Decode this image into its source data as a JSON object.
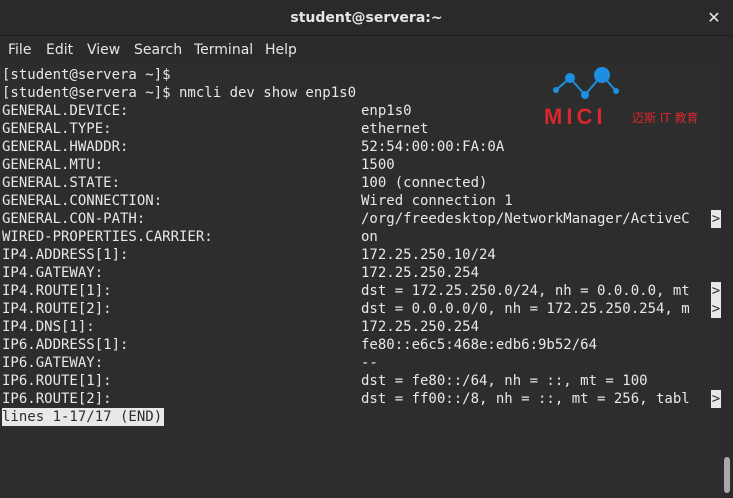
{
  "window": {
    "title": "student@servera:~"
  },
  "menu": [
    "File",
    "Edit",
    "View",
    "Search",
    "Terminal",
    "Help"
  ],
  "logo": {
    "brand": "MICI",
    "tagline": "迈斯 IT 教育"
  },
  "terminal": {
    "prompt1": "[student@servera ~]$",
    "prompt2": "[student@servera ~]$ nmcli dev show enp1s0",
    "rows": [
      {
        "key": "GENERAL.DEVICE:",
        "value": "enp1s0"
      },
      {
        "key": "GENERAL.TYPE:",
        "value": "ethernet"
      },
      {
        "key": "GENERAL.HWADDR:",
        "value": "52:54:00:00:FA:0A"
      },
      {
        "key": "GENERAL.MTU:",
        "value": "1500"
      },
      {
        "key": "GENERAL.STATE:",
        "value": "100 (connected)"
      },
      {
        "key": "GENERAL.CONNECTION:",
        "value": "Wired connection 1"
      },
      {
        "key": "GENERAL.CON-PATH:",
        "value": "/org/freedesktop/NetworkManager/ActiveC",
        "truncated": true
      },
      {
        "key": "WIRED-PROPERTIES.CARRIER:",
        "value": "on"
      },
      {
        "key": "IP4.ADDRESS[1]:",
        "value": "172.25.250.10/24"
      },
      {
        "key": "IP4.GATEWAY:",
        "value": "172.25.250.254"
      },
      {
        "key": "IP4.ROUTE[1]:",
        "value": "dst = 172.25.250.0/24, nh = 0.0.0.0, mt",
        "truncated": true
      },
      {
        "key": "IP4.ROUTE[2]:",
        "value": "dst = 0.0.0.0/0, nh = 172.25.250.254, m",
        "truncated": true
      },
      {
        "key": "IP4.DNS[1]:",
        "value": "172.25.250.254"
      },
      {
        "key": "IP6.ADDRESS[1]:",
        "value": "fe80::e6c5:468e:edb6:9b52/64"
      },
      {
        "key": "IP6.GATEWAY:",
        "value": "--"
      },
      {
        "key": "IP6.ROUTE[1]:",
        "value": "dst = fe80::/64, nh = ::, mt = 100"
      },
      {
        "key": "IP6.ROUTE[2]:",
        "value": "dst = ff00::/8, nh = ::, mt = 256, tabl",
        "truncated": true
      }
    ],
    "truncation_marker": ">",
    "pager_status": "lines 1-17/17 (END)"
  },
  "colors": {
    "background": "#2d2d2d",
    "foreground": "#e8e8e8",
    "logo_blue": "#1e8fe0",
    "logo_red": "#d8282d"
  }
}
